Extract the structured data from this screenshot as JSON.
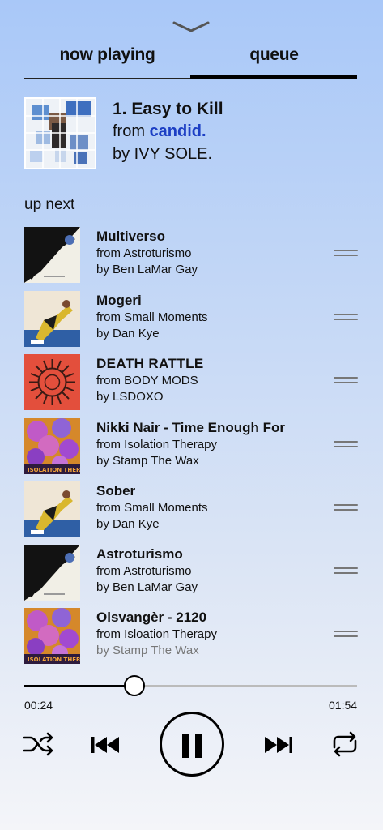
{
  "tabs": {
    "now_playing": "now playing",
    "queue": "queue",
    "active": "queue"
  },
  "current_track": {
    "title": "1. Easy to Kill",
    "from_prefix": "from ",
    "album": "candid.",
    "artist_line": "by IVY SOLE."
  },
  "up_next_label": "up next",
  "queue": [
    {
      "title": "Multiverso",
      "album_line": "from Astroturismo",
      "artist_line": "by Ben LaMar Gay",
      "art": "astroturismo-cover"
    },
    {
      "title": "Mogeri",
      "album_line": "from Small Moments",
      "artist_line": "by Dan Kye",
      "art": "small-moments-cover"
    },
    {
      "title": "DEATH RATTLE",
      "album_line": "from BODY MODS",
      "artist_line": "by LSDOXO",
      "art": "body-mods-cover"
    },
    {
      "title": "Nikki Nair - Time Enough For",
      "album_line": "from Isolation Therapy",
      "artist_line": "by Stamp The Wax",
      "art": "isolation-therapy-cover"
    },
    {
      "title": "Sober",
      "album_line": "from Small Moments",
      "artist_line": "by Dan Kye",
      "art": "small-moments-cover"
    },
    {
      "title": "Astroturismo",
      "album_line": "from Astroturismo",
      "artist_line": "by Ben LaMar Gay",
      "art": "astroturismo-cover"
    },
    {
      "title": "Olsvangèr - 2120",
      "album_line": "from Isloation Therapy",
      "artist_line": "by Stamp The Wax",
      "art": "isolation-therapy-cover"
    }
  ],
  "playback": {
    "elapsed": "00:24",
    "total": "01:54",
    "progress_fraction": 0.33,
    "state": "playing"
  },
  "icons": {
    "collapse": "chevron-down-icon",
    "shuffle": "shuffle-icon",
    "previous": "skip-previous-icon",
    "pause": "pause-icon",
    "next": "skip-next-icon",
    "repeat": "repeat-icon",
    "reorder": "drag-handle-icon"
  },
  "colors": {
    "album_link": "#1d3fc4",
    "accent": "#000000"
  }
}
